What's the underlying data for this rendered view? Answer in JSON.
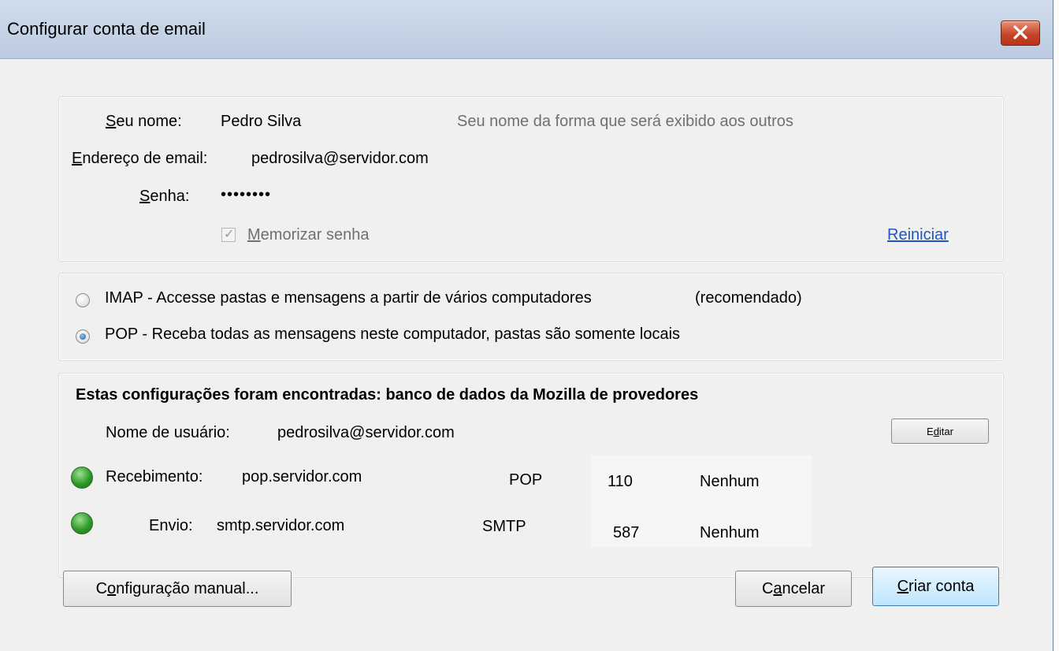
{
  "window": {
    "title": "Configurar conta de email"
  },
  "identity": {
    "name_label": "Seu nome:",
    "name_value": "Pedro Silva",
    "name_hint": "Seu nome da forma que será exibido aos outros",
    "email_label": "Endereço de email:",
    "email_value": "pedrosilva@servidor.com",
    "password_label": "Senha:",
    "password_value": "••••••••",
    "remember_label": "Memorizar senha",
    "remember_checked": true,
    "reset_link": "Reiniciar"
  },
  "protocol": {
    "imap_label": "IMAP - Accesse pastas e mensagens a partir de vários computadores",
    "imap_note": "(recomendado)",
    "pop_label": "POP - Receba todas as mensagens neste computador, pastas são somente locais",
    "selected": "POP"
  },
  "found": {
    "heading": "Estas configurações foram encontradas: banco de dados da Mozilla de provedores",
    "username_label": "Nome de usuário:",
    "username_value": "pedrosilva@servidor.com",
    "edit_button": "Editar",
    "incoming": {
      "label": "Recebimento:",
      "host": "pop.servidor.com",
      "protocol": "POP",
      "port": "110",
      "security": "Nenhum",
      "status_color": "#2f9a2a"
    },
    "outgoing": {
      "label": "Envio:",
      "host": "smtp.servidor.com",
      "protocol": "SMTP",
      "port": "587",
      "security": "Nenhum",
      "status_color": "#2f9a2a"
    }
  },
  "buttons": {
    "manual": "Configuração manual...",
    "cancel": "Cancelar",
    "create": "Criar conta"
  }
}
